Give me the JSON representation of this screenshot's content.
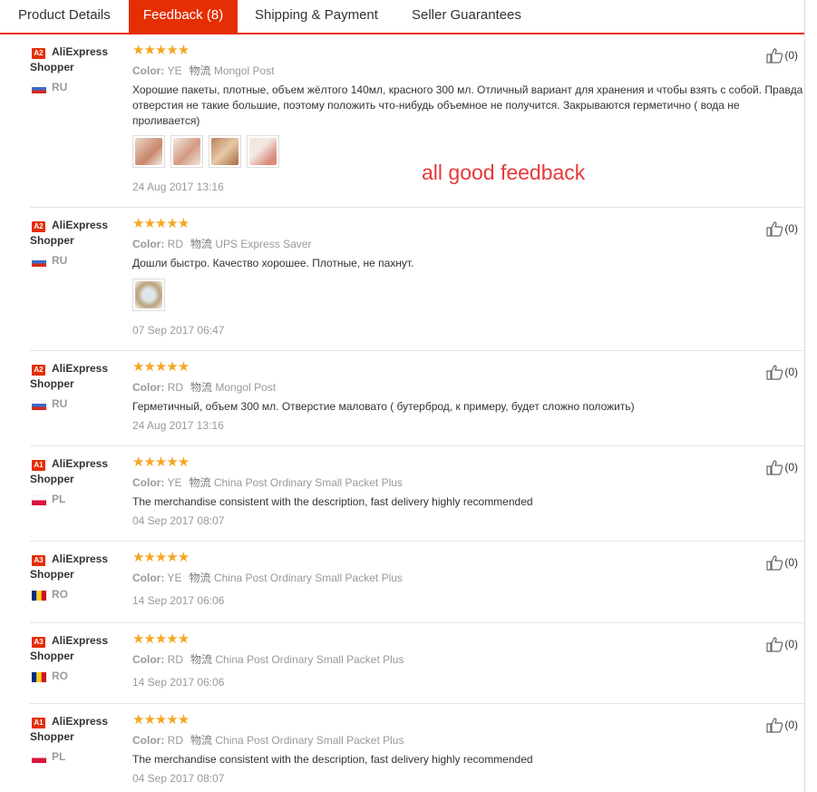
{
  "tabs": [
    "Product Details",
    "Feedback (8)",
    "Shipping & Payment",
    "Seller Guarantees"
  ],
  "active_tab": 1,
  "overlay_text": "all good feedback",
  "accent_color": "#e62e04",
  "icons": {
    "stars": "five-star-rating-icon",
    "like": "thumbs-up-icon",
    "flag": "country-flag-icon"
  },
  "reviews": [
    {
      "badge": "A2",
      "name": "AliExpress Shopper",
      "country": "RU",
      "stars": "★★★★★",
      "color_label": "Color:",
      "color": "YE",
      "wuliu": "物流",
      "shipping": "Mongol Post",
      "text": "Хорошие пакеты, плотные, объем жёлтого 140мл, красного 300 мл. Отличный вариант для хранения и чтобы взять с собой. Правда отверстия не такие большие, поэтому положить что-нибудь объемное не получится. Закрываются герметично ( вода не проливается)",
      "photos": 4,
      "date": "24 Aug 2017 13:16",
      "likes": "(0)"
    },
    {
      "badge": "A2",
      "name": "AliExpress Shopper",
      "country": "RU",
      "stars": "★★★★★",
      "color_label": "Color:",
      "color": "RD",
      "wuliu": "物流",
      "shipping": "UPS Express Saver",
      "text": "Дошли быстро. Качество хорошее. Плотные, не пахнут.",
      "photos": 1,
      "date": "07 Sep 2017 06:47",
      "likes": "(0)"
    },
    {
      "badge": "A2",
      "name": "AliExpress Shopper",
      "country": "RU",
      "stars": "★★★★★",
      "color_label": "Color:",
      "color": "RD",
      "wuliu": "物流",
      "shipping": "Mongol Post",
      "text": "Герметичный, объем 300 мл. Отверстие маловато ( бутерброд, к примеру, будет сложно положить)",
      "photos": 0,
      "date": "24 Aug 2017 13:16",
      "likes": "(0)"
    },
    {
      "badge": "A1",
      "name": "AliExpress Shopper",
      "country": "PL",
      "stars": "★★★★★",
      "color_label": "Color:",
      "color": "YE",
      "wuliu": "物流",
      "shipping": "China Post Ordinary Small Packet Plus",
      "text": "The merchandise consistent with the description, fast delivery highly recommended",
      "photos": 0,
      "date": "04 Sep 2017 08:07",
      "likes": "(0)"
    },
    {
      "badge": "A3",
      "name": "AliExpress Shopper",
      "country": "RO",
      "stars": "★★★★★",
      "color_label": "Color:",
      "color": "YE",
      "wuliu": "物流",
      "shipping": "China Post Ordinary Small Packet Plus",
      "text": "",
      "photos": 0,
      "date": "14 Sep 2017 06:06",
      "likes": "(0)"
    },
    {
      "badge": "A3",
      "name": "AliExpress Shopper",
      "country": "RO",
      "stars": "★★★★★",
      "color_label": "Color:",
      "color": "RD",
      "wuliu": "物流",
      "shipping": "China Post Ordinary Small Packet Plus",
      "text": "",
      "photos": 0,
      "date": "14 Sep 2017 06:06",
      "likes": "(0)"
    },
    {
      "badge": "A1",
      "name": "AliExpress Shopper",
      "country": "PL",
      "stars": "★★★★★",
      "color_label": "Color:",
      "color": "RD",
      "wuliu": "物流",
      "shipping": "China Post Ordinary Small Packet Plus",
      "text": "The merchandise consistent with the description, fast delivery highly recommended",
      "photos": 0,
      "date": "04 Sep 2017 08:07",
      "likes": "(0)"
    }
  ]
}
